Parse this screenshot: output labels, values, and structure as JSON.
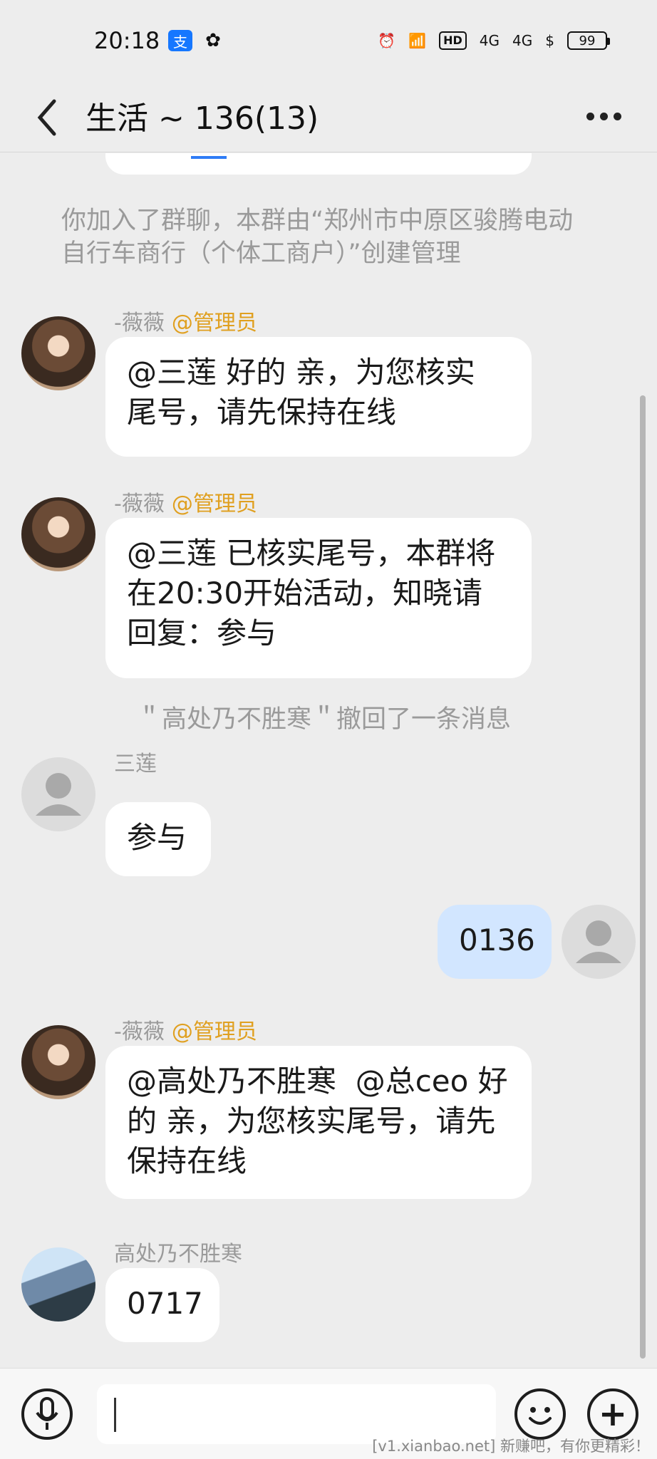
{
  "status": {
    "time": "20:18",
    "apps": [
      "alipay-icon",
      "wechat-icon"
    ],
    "battery": "99",
    "network": "4G"
  },
  "header": {
    "title": "生活 ~ 136(13)"
  },
  "chat": {
    "system1": "你加入了群聊，本群由“郑州市中原区骏腾电动自行车商行（个体工商户）”创建管理",
    "messages": [
      {
        "sender": "-薇薇",
        "role": "@管理员",
        "text": "@三莲 好的 亲，为您核实\n尾号，请先保持在线"
      },
      {
        "sender": "-薇薇",
        "role": "@管理员",
        "text": "@三莲 已核实尾号，本群将\n在20:30开始活动，知晓请\n回复：参与"
      },
      {
        "sender": "三莲",
        "text": "参与"
      },
      {
        "mine": true,
        "text": "0136"
      },
      {
        "sender": "-薇薇",
        "role": "@管理员",
        "text": "@高处乃不胜寒  @总ceo 好\n的 亲，为您核实尾号，请先\n保持在线"
      },
      {
        "sender": "高处乃不胜寒",
        "text": "0717"
      }
    ],
    "system2": "＂高处乃不胜寒＂撤回了一条消息"
  },
  "watermark": "[v1.xianbao.net] 新赚吧，有你更精彩！",
  "colors": {
    "admin": "#e0a020",
    "mine_bubble": "#d2e6ff",
    "accent": "#2f7cf6"
  }
}
